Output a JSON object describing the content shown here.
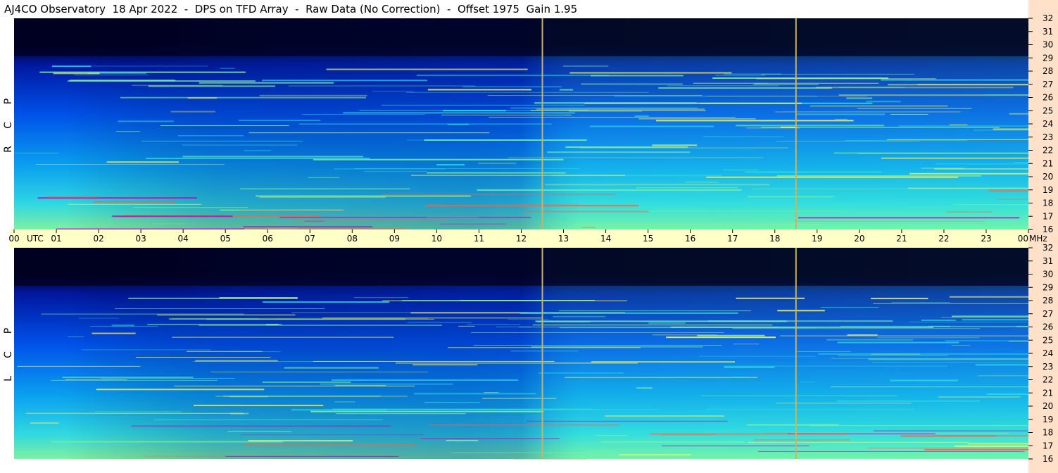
{
  "title": "AJ4CO Observatory  18 Apr 2022  -  DPS on TFD Array  -  Raw Data (No Correction)  -  Offset 1975  Gain 1.95",
  "colors": {
    "background": "#ffffff",
    "time_axis_band": "#ffffc8",
    "freq_axis_band": "#ffe0c8",
    "event_line": "#c8b464",
    "colormap": [
      "#000020",
      "#0018a0",
      "#0050e8",
      "#0aa0f0",
      "#30d8e0",
      "#80f0a0",
      "#f0f060",
      "#ff6040",
      "#c000c0"
    ]
  },
  "chart_data": [
    {
      "type": "heatmap",
      "panel": "RCP",
      "ylabel": "R C P",
      "x_range_hours": [
        0,
        24
      ],
      "y_range_mhz": [
        16,
        32
      ],
      "y_ticks": [
        "16",
        "17",
        "18",
        "19",
        "20",
        "21",
        "22",
        "23",
        "24",
        "25",
        "26",
        "27",
        "28",
        "29",
        "30",
        "31",
        "32"
      ],
      "event_lines_utc": [
        12.5,
        18.5
      ]
    },
    {
      "type": "heatmap",
      "panel": "LCP",
      "ylabel": "L C P",
      "x_range_hours": [
        0,
        24
      ],
      "y_range_mhz": [
        16,
        32
      ],
      "y_ticks": [
        "16",
        "17",
        "18",
        "19",
        "20",
        "21",
        "22",
        "23",
        "24",
        "25",
        "26",
        "27",
        "28",
        "29",
        "30",
        "31",
        "32"
      ],
      "event_lines_utc": [
        12.5,
        18.5
      ]
    }
  ],
  "time_axis": {
    "ticks": [
      "00",
      "01",
      "02",
      "03",
      "04",
      "05",
      "06",
      "07",
      "08",
      "09",
      "10",
      "11",
      "12",
      "13",
      "14",
      "15",
      "16",
      "17",
      "18",
      "19",
      "20",
      "21",
      "22",
      "23",
      "00"
    ],
    "utc_label": "UTC",
    "freq_unit": "MHz"
  }
}
